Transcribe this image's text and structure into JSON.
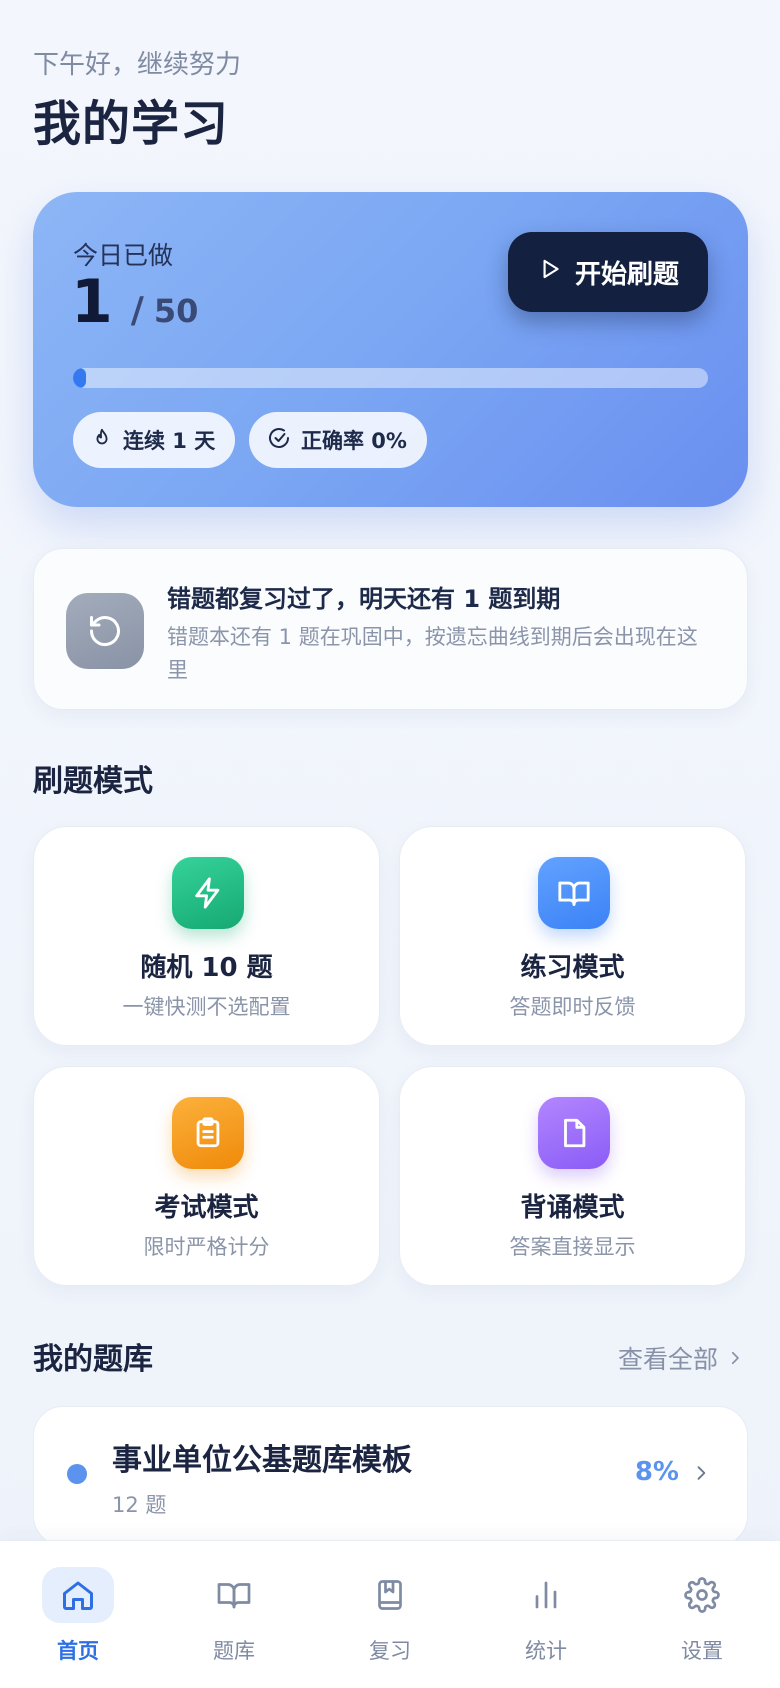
{
  "header": {
    "greeting": "下午好，继续努力",
    "title": "我的学习"
  },
  "today": {
    "label": "今日已做",
    "done": "1",
    "slash": "/",
    "total": "50",
    "progress_fraction": 0.02,
    "start_label": "开始刷题",
    "streak": "连续 1 天",
    "accuracy": "正确率 0%"
  },
  "review": {
    "title": "错题都复习过了，明天还有 1 题到期",
    "desc": "错题本还有 1 题在巩固中，按遗忘曲线到期后会出现在这里"
  },
  "modes": {
    "title": "刷题模式",
    "items": [
      {
        "label": "随机 10 题",
        "sub": "一键快测不选配置",
        "icon": "lightning-icon",
        "color": "#16a873"
      },
      {
        "label": "练习模式",
        "sub": "答题即时反馈",
        "icon": "book-open-icon",
        "color": "#3b82f6"
      },
      {
        "label": "考试模式",
        "sub": "限时严格计分",
        "icon": "clipboard-icon",
        "color": "#f08a0a"
      },
      {
        "label": "背诵模式",
        "sub": "答案直接显示",
        "icon": "file-icon",
        "color": "#8b5cf6"
      }
    ]
  },
  "banks": {
    "title": "我的题库",
    "view_all": "查看全部",
    "items": [
      {
        "name": "事业单位公基题库模板",
        "count": "12 题",
        "percent": "8%"
      }
    ]
  },
  "nav": {
    "items": [
      {
        "label": "首页",
        "icon": "home-icon",
        "active": true
      },
      {
        "label": "题库",
        "icon": "book-icon",
        "active": false
      },
      {
        "label": "复习",
        "icon": "bookmark-book-icon",
        "active": false
      },
      {
        "label": "统计",
        "icon": "bar-chart-icon",
        "active": false
      },
      {
        "label": "设置",
        "icon": "gear-icon",
        "active": false
      }
    ]
  },
  "colors": {
    "accent": "#2f6fe6",
    "dark_button": "#13203f",
    "bank_accent": "#5b93ee"
  }
}
